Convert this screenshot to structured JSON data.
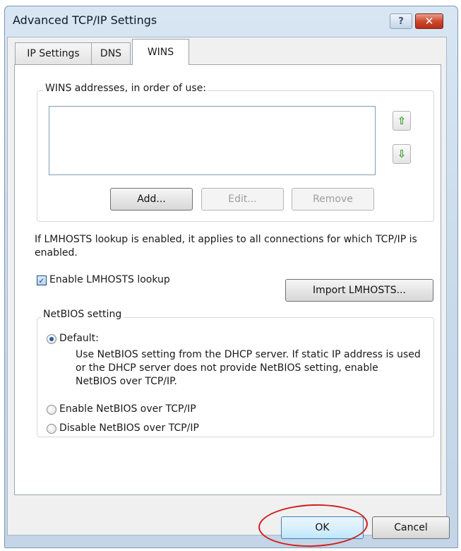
{
  "window": {
    "title": "Advanced TCP/IP Settings",
    "help_label": "?",
    "close_label": "✕"
  },
  "tabs": [
    {
      "label": "IP Settings",
      "active": false
    },
    {
      "label": "DNS",
      "active": false
    },
    {
      "label": "WINS",
      "active": true
    }
  ],
  "wins": {
    "group_label": "WINS addresses, in order of use:",
    "addresses": [],
    "up_icon": "arrow-up-icon",
    "down_icon": "arrow-down-icon",
    "up_glyph": "⇧",
    "down_glyph": "⇩",
    "add_label": "Add...",
    "edit_label": "Edit...",
    "remove_label": "Remove"
  },
  "lmhosts": {
    "description": "If LMHOSTS lookup is enabled, it applies to all connections for which TCP/IP is enabled.",
    "checkbox_label": "Enable LMHOSTS lookup",
    "checked": true,
    "check_glyph": "✓",
    "import_label": "Import LMHOSTS..."
  },
  "netbios": {
    "group_label": "NetBIOS setting",
    "options": [
      {
        "label": "Default:",
        "selected": true
      },
      {
        "label": "Enable NetBIOS over TCP/IP",
        "selected": false
      },
      {
        "label": "Disable NetBIOS over TCP/IP",
        "selected": false
      }
    ],
    "default_description": "Use NetBIOS setting from the DHCP server. If static IP address is used or the DHCP server does not provide NetBIOS setting, enable NetBIOS over TCP/IP."
  },
  "footer": {
    "ok_label": "OK",
    "cancel_label": "Cancel"
  },
  "colors": {
    "annotation": "#d11e1e",
    "title_bar": "#c7d9ea",
    "close_button": "#cc4a2f"
  }
}
